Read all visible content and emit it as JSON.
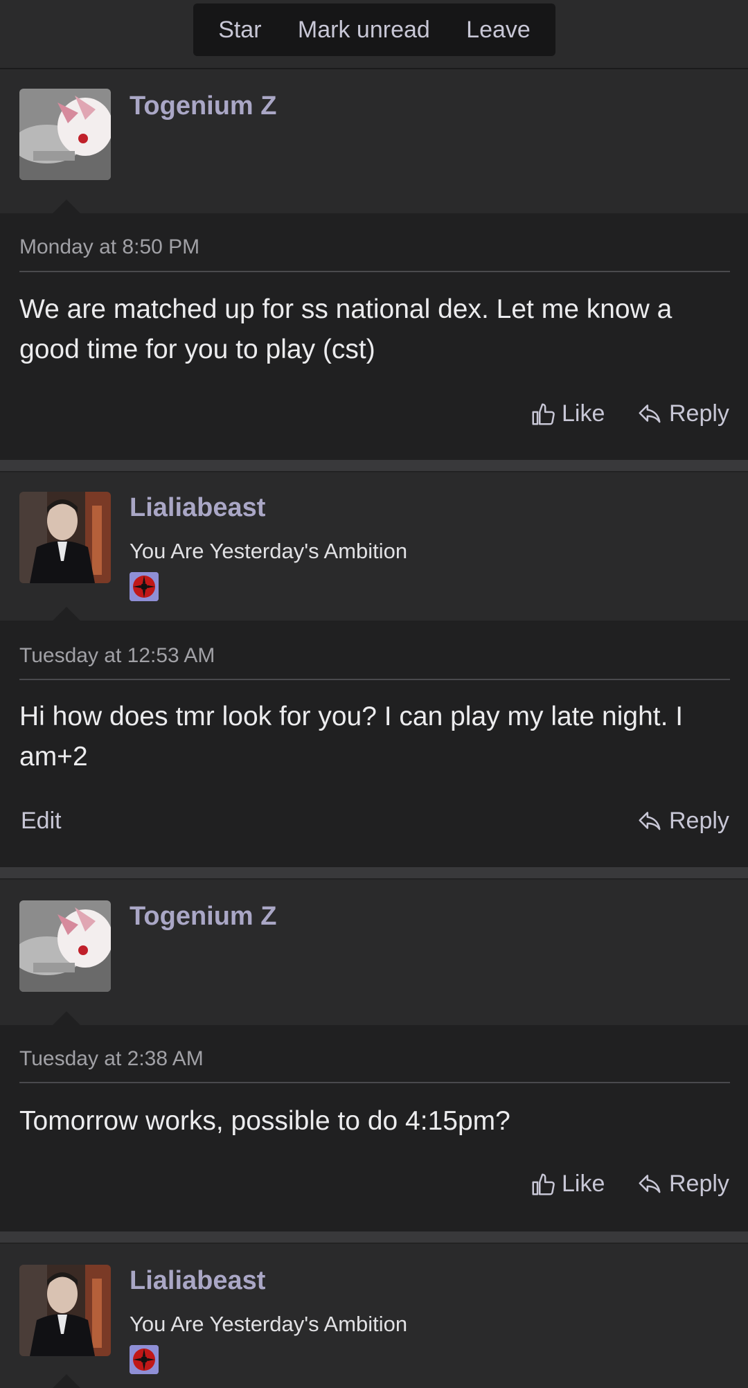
{
  "toolbar": {
    "star": "Star",
    "mark_unread": "Mark unread",
    "leave": "Leave"
  },
  "messages": [
    {
      "author": "Togenium Z",
      "user_title": "",
      "date": "Monday at 8:50 PM",
      "body": "We are matched up for ss national dex. Let me know a good time for you to play (cst)",
      "like": "Like",
      "reply": "Reply",
      "edit": ""
    },
    {
      "author": "Lialiabeast",
      "user_title": "You Are Yesterday's Ambition",
      "date": "Tuesday at 12:53 AM",
      "body": "Hi how does tmr look for you? I can play my late night. I am+2",
      "like": "",
      "reply": "Reply",
      "edit": "Edit"
    },
    {
      "author": "Togenium Z",
      "user_title": "",
      "date": "Tuesday at 2:38 AM",
      "body": "Tomorrow works, possible to do 4:15pm?",
      "like": "Like",
      "reply": "Reply",
      "edit": ""
    },
    {
      "author": "Lialiabeast",
      "user_title": "You Are Yesterday's Ambition"
    }
  ]
}
